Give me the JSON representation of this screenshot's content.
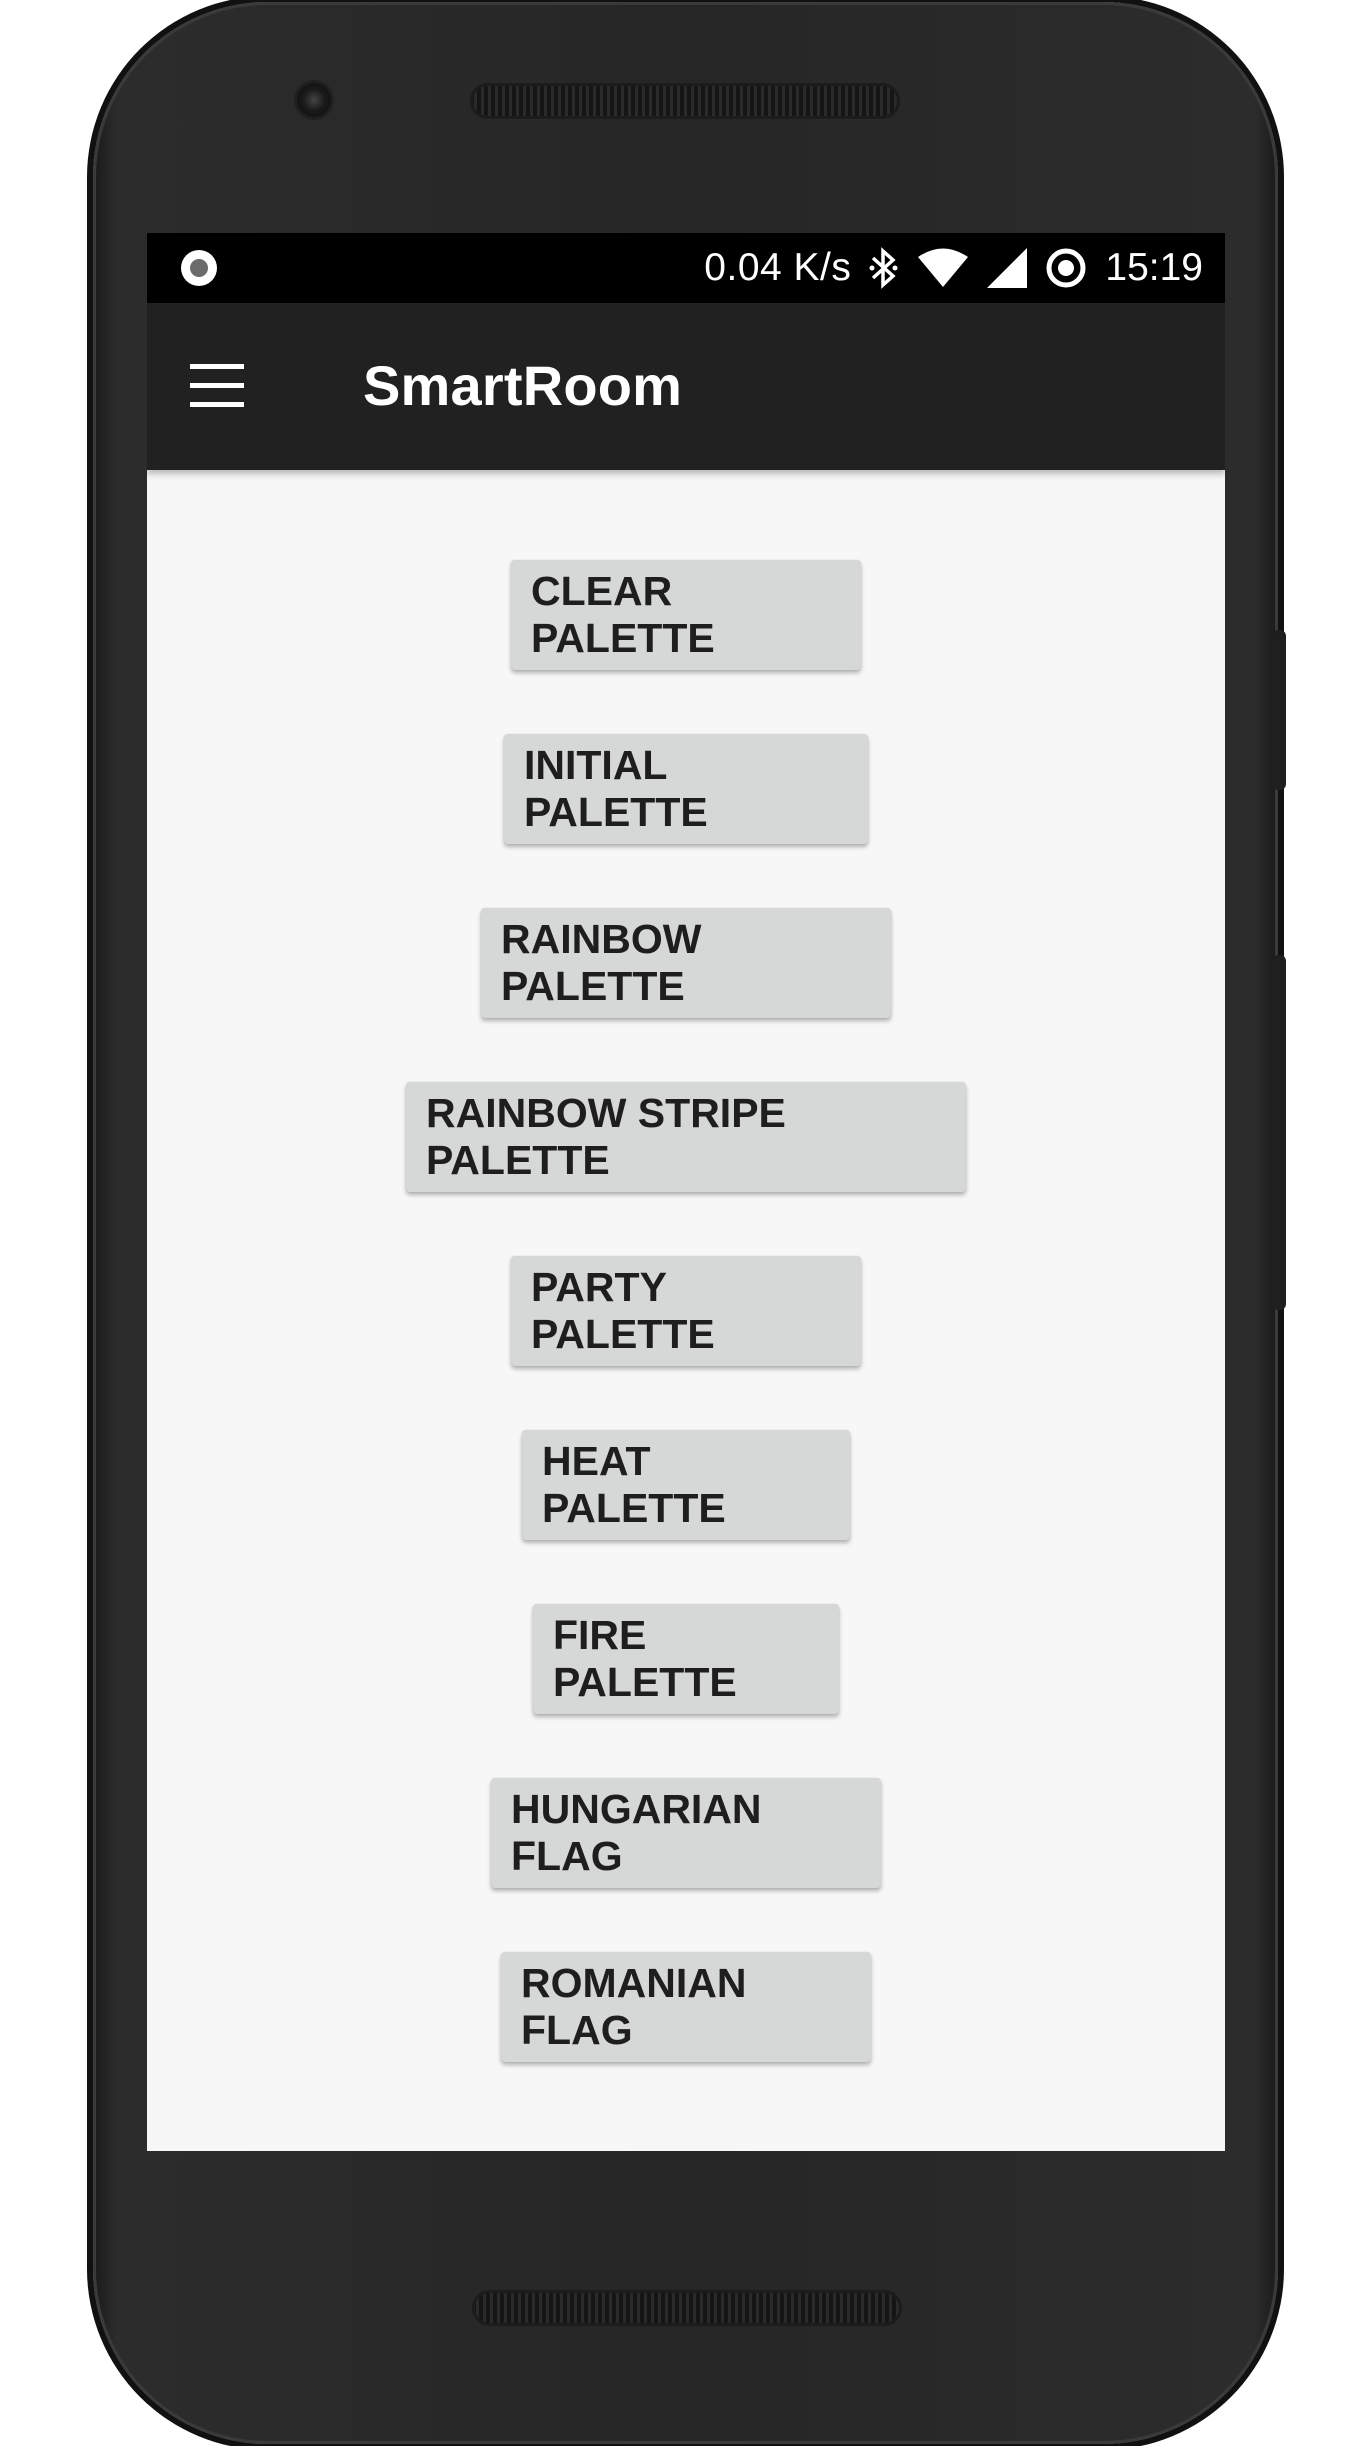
{
  "status_bar": {
    "left_icon": "circle-record-icon",
    "network_speed": "0.04 K/s",
    "icons": [
      "bluetooth-icon",
      "wifi-icon",
      "cell-signal-icon",
      "sync-circle-icon"
    ],
    "time": "15:19"
  },
  "app_bar": {
    "menu_icon": "hamburger-menu-icon",
    "title": "SmartRoom"
  },
  "buttons": [
    {
      "label": "CLEAR PALETTE"
    },
    {
      "label": "INITIAL PALETTE"
    },
    {
      "label": "RAINBOW PALETTE"
    },
    {
      "label": "RAINBOW STRIPE PALETTE"
    },
    {
      "label": "PARTY PALETTE"
    },
    {
      "label": "HEAT PALETTE"
    },
    {
      "label": "FIRE PALETTE"
    },
    {
      "label": "HUNGARIAN FLAG"
    },
    {
      "label": "ROMANIAN FLAG"
    }
  ],
  "colors": {
    "status_bar": "#000000",
    "app_bar": "#212121",
    "screen_bg": "#f7f7f7",
    "button_bg": "#d6d7d7",
    "button_text": "#1e1e1e",
    "phone_body": "#262626"
  }
}
